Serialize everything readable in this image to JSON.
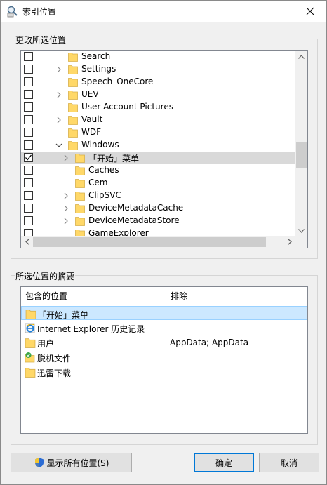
{
  "window": {
    "title": "索引位置"
  },
  "tree_group": {
    "label": "更改所选位置",
    "rows": [
      {
        "label": "Search",
        "checked": false,
        "expander": false,
        "level": 0
      },
      {
        "label": "Settings",
        "checked": false,
        "expander": true,
        "level": 0
      },
      {
        "label": "Speech_OneCore",
        "checked": false,
        "expander": false,
        "level": 0
      },
      {
        "label": "UEV",
        "checked": false,
        "expander": true,
        "level": 0
      },
      {
        "label": "User Account Pictures",
        "checked": false,
        "expander": false,
        "level": 0
      },
      {
        "label": "Vault",
        "checked": false,
        "expander": true,
        "level": 0
      },
      {
        "label": "WDF",
        "checked": false,
        "expander": false,
        "level": 0
      },
      {
        "label": "Windows",
        "checked": false,
        "expander": "open",
        "level": 0
      },
      {
        "label": "「开始」菜单",
        "checked": true,
        "expander": true,
        "level": 1,
        "selected": true
      },
      {
        "label": "Caches",
        "checked": false,
        "expander": false,
        "level": 1
      },
      {
        "label": "Cem",
        "checked": false,
        "expander": false,
        "level": 1
      },
      {
        "label": "ClipSVC",
        "checked": false,
        "expander": true,
        "level": 1
      },
      {
        "label": "DeviceMetadataCache",
        "checked": false,
        "expander": true,
        "level": 1
      },
      {
        "label": "DeviceMetadataStore",
        "checked": false,
        "expander": true,
        "level": 1
      },
      {
        "label": "GameExplorer",
        "checked": false,
        "expander": false,
        "level": 1
      }
    ]
  },
  "summary_group": {
    "label": "所选位置的摘要",
    "col_included": "包含的位置",
    "col_excluded": "排除",
    "rows": [
      {
        "label": "「开始」菜单",
        "exclude": "",
        "icon": "folder-icon",
        "selected": true
      },
      {
        "label": "Internet Explorer 历史记录",
        "exclude": "",
        "icon": "internet-explorer-icon"
      },
      {
        "label": "用户",
        "exclude": "AppData; AppData",
        "icon": "folder-icon"
      },
      {
        "label": "脱机文件",
        "exclude": "",
        "icon": "offline-files-icon"
      },
      {
        "label": "迅雷下载",
        "exclude": "",
        "icon": "folder-icon"
      }
    ]
  },
  "buttons": {
    "show_all": "显示所有位置(S)",
    "ok": "确定",
    "cancel": "取消"
  },
  "colors": {
    "selection_gray": "#d9d9d9",
    "selection_blue": "#cce8ff",
    "folder_yellow": "#ffd868",
    "default_button_border": "#0078d7"
  }
}
